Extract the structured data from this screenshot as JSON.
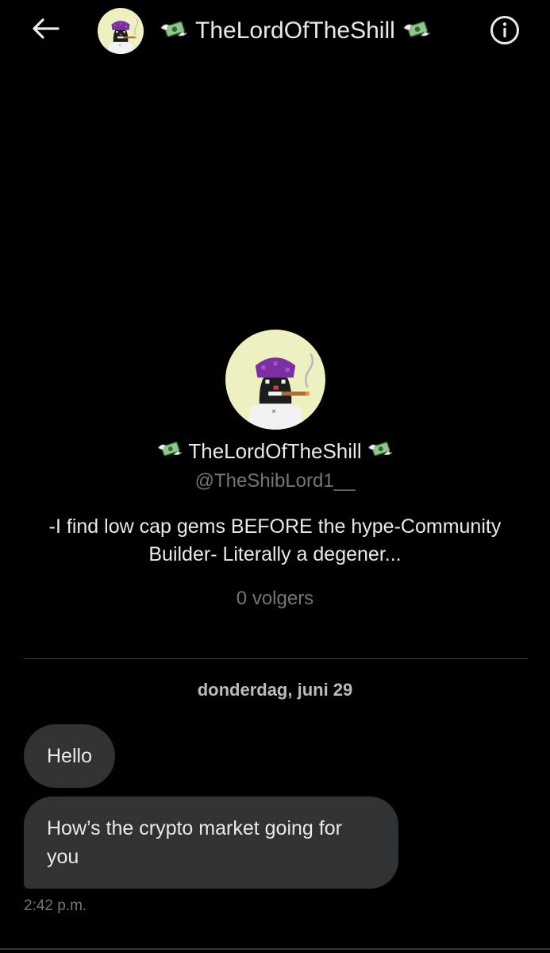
{
  "header": {
    "title": "TheLordOfTheShill",
    "back_icon": "arrow-left-icon",
    "info_icon": "info-circle-icon",
    "title_emoji": "money-with-wings-emoji"
  },
  "profile": {
    "display_name": "TheLordOfTheShill",
    "handle": "@TheShibLord1__",
    "bio": "-I find low cap gems BEFORE the hype-Community Builder- Literally a degener...",
    "followers": "0 volgers"
  },
  "conversation": {
    "date": "donderdag, juni 29",
    "messages": [
      {
        "text": "Hello"
      },
      {
        "text": "How’s the crypto market going for you"
      }
    ],
    "timestamp": "2:42 p.m."
  },
  "colors": {
    "background": "#000000",
    "bubble": "#2f3336",
    "text": "#e7e9ea",
    "muted": "#71767b",
    "avatar_bg": "#eef0bf"
  }
}
